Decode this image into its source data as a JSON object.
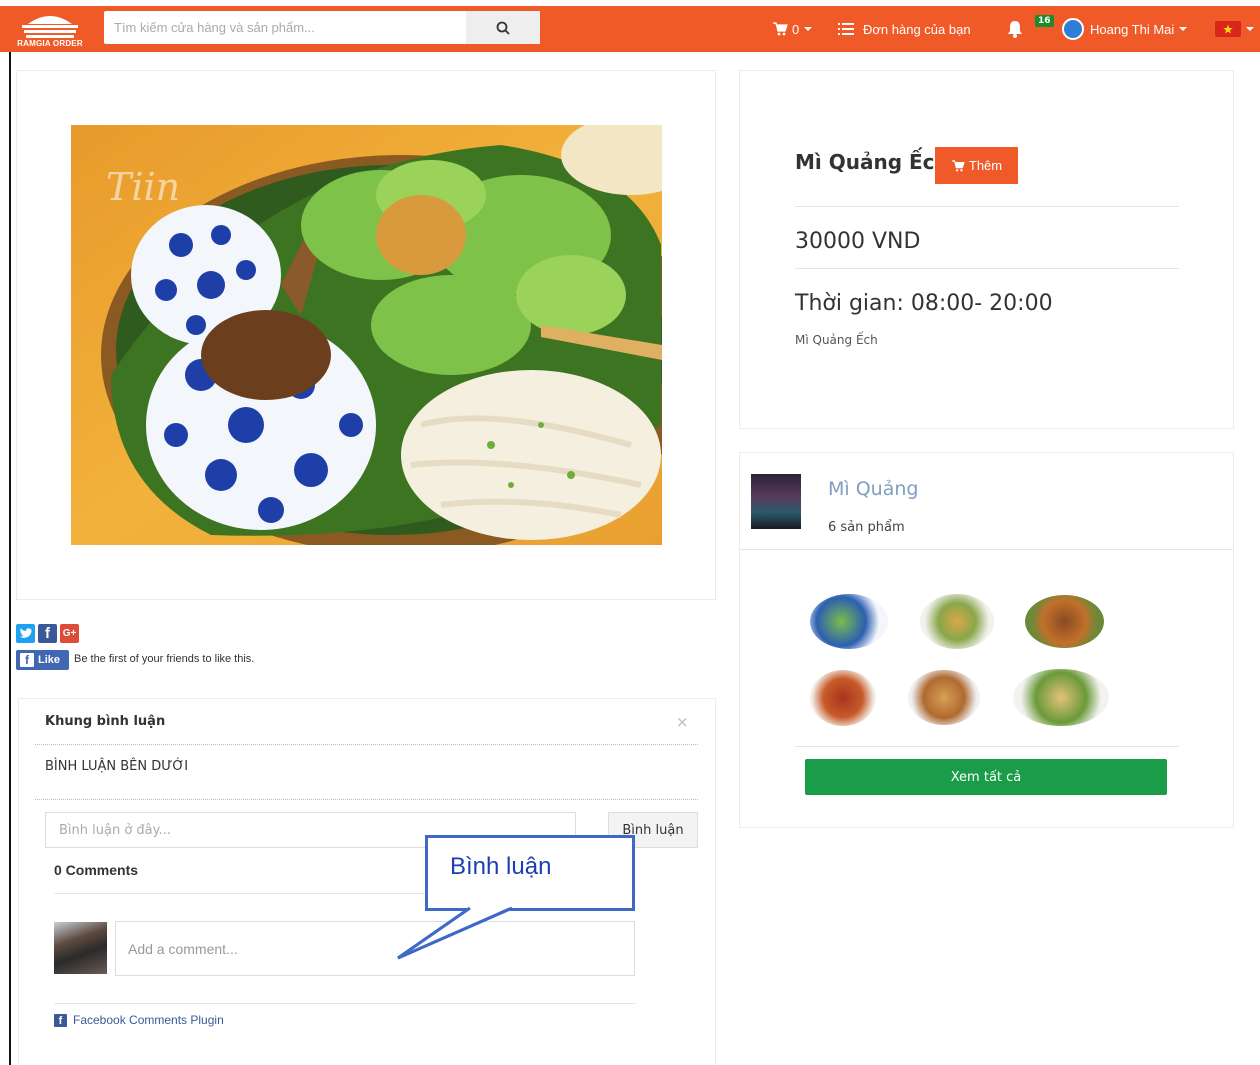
{
  "navbar": {
    "logo_text": "RAMGIA ORDER",
    "search_placeholder": "Tìm kiếm cửa hàng và sản phẩm...",
    "cart_count": "0",
    "orders_label": "Đơn hàng của bạn",
    "notification_count": "16",
    "user_name": "Hoang Thi Mai",
    "accent_color": "#f05a28"
  },
  "product": {
    "title": "Mì Quảng Ếch",
    "add_label": "Thêm",
    "price": "30000 VND",
    "hours": "Thời gian: 08:00- 20:00",
    "description": "Mì Quảng Ếch"
  },
  "shop": {
    "name": "Mì Quảng",
    "product_count": "6 sản phẩm",
    "view_all_label": "Xem tất cả"
  },
  "social": {
    "like_label": "Like",
    "like_text": "Be the first of your friends to like this."
  },
  "comments": {
    "header": "Khung bình luận",
    "subheader": "BÌNH LUẬN BÊN DƯỚI",
    "input_placeholder": "Bình luận ở đây...",
    "submit_label": "Bình luận",
    "count_label": "0 Comments",
    "add_placeholder": "Add a comment...",
    "plugin_label": "Facebook Comments Plugin"
  },
  "callout": {
    "text": "Bình luận"
  }
}
